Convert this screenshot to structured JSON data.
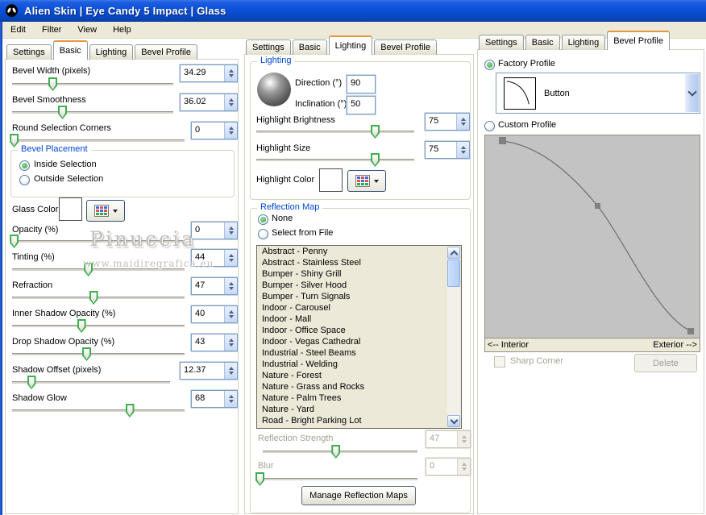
{
  "titlebar": {
    "title": "Alien Skin | Eye Candy 5 Impact | Glass"
  },
  "menubar": {
    "edit": "Edit",
    "filter": "Filter",
    "view": "View",
    "help": "Help"
  },
  "tabs": {
    "settings": "Settings",
    "basic": "Basic",
    "lighting": "Lighting",
    "bevel_profile": "Bevel Profile"
  },
  "left": {
    "rows": {
      "bevel_width": {
        "label": "Bevel Width (pixels)",
        "value": "34.29"
      },
      "bevel_smoothness": {
        "label": "Bevel Smoothness",
        "value": "36.02"
      },
      "round_corners": {
        "label": "Round Selection Corners",
        "value": "0"
      },
      "opacity": {
        "label": "Opacity (%)",
        "value": "0"
      },
      "tinting": {
        "label": "Tinting (%)",
        "value": "44"
      },
      "refraction": {
        "label": "Refraction",
        "value": "47"
      },
      "inner_shadow": {
        "label": "Inner Shadow Opacity (%)",
        "value": "40"
      },
      "drop_shadow": {
        "label": "Drop Shadow Opacity (%)",
        "value": "43"
      },
      "shadow_offset": {
        "label": "Shadow Offset (pixels)",
        "value": "12.37"
      },
      "shadow_glow": {
        "label": "Shadow Glow",
        "value": "68"
      }
    },
    "placement": {
      "title": "Bevel Placement",
      "inside": "Inside Selection",
      "outside": "Outside Selection"
    },
    "glass_color_label": "Glass Color",
    "glass_color": "#ffffff",
    "watermark": {
      "line1": "Pinuccia",
      "line2": "www.maidiregrafica.eu"
    }
  },
  "middle": {
    "lighting": {
      "title": "Lighting",
      "direction_label": "Direction (°)",
      "direction_value": "90",
      "inclination_label": "Inclination (°)",
      "inclination_value": "50",
      "brightness": {
        "label": "Highlight Brightness",
        "value": "75"
      },
      "size": {
        "label": "Highlight Size",
        "value": "75"
      },
      "highlight_color_label": "Highlight Color",
      "highlight_color": "#ffffff"
    },
    "reflection": {
      "title": "Reflection Map",
      "none_label": "None",
      "file_label": "Select from File",
      "items": [
        "Abstract - Penny",
        "Abstract - Stainless Steel",
        "Bumper - Shiny Grill",
        "Bumper - Silver Hood",
        "Bumper - Turn Signals",
        "Indoor - Carousel",
        "Indoor - Mall",
        "Indoor - Office Space",
        "Indoor - Vegas Cathedral",
        "Industrial - Steel Beams",
        "Industrial - Welding",
        "Nature - Forest",
        "Nature - Grass and Rocks",
        "Nature - Palm Trees",
        "Nature - Yard",
        "Road - Bright Parking Lot"
      ],
      "strength": {
        "label": "Reflection Strength",
        "value": "47"
      },
      "blur": {
        "label": "Blur",
        "value": "0"
      },
      "manage_label": "Manage Reflection Maps"
    }
  },
  "right": {
    "factory_label": "Factory Profile",
    "profile_name": "Button",
    "custom_label": "Custom Profile",
    "interior_label": "<-- Interior",
    "exterior_label": "Exterior -->",
    "sharp_label": "Sharp Corner",
    "delete_label": "Delete"
  },
  "colors": {
    "titlebar_blue": "#0a50d8",
    "tab_accent_orange": "#e6963c",
    "group_title_blue": "#0046d5",
    "slider_thumb_green": "#3fae4e",
    "list_bg": "#ece9d8"
  }
}
